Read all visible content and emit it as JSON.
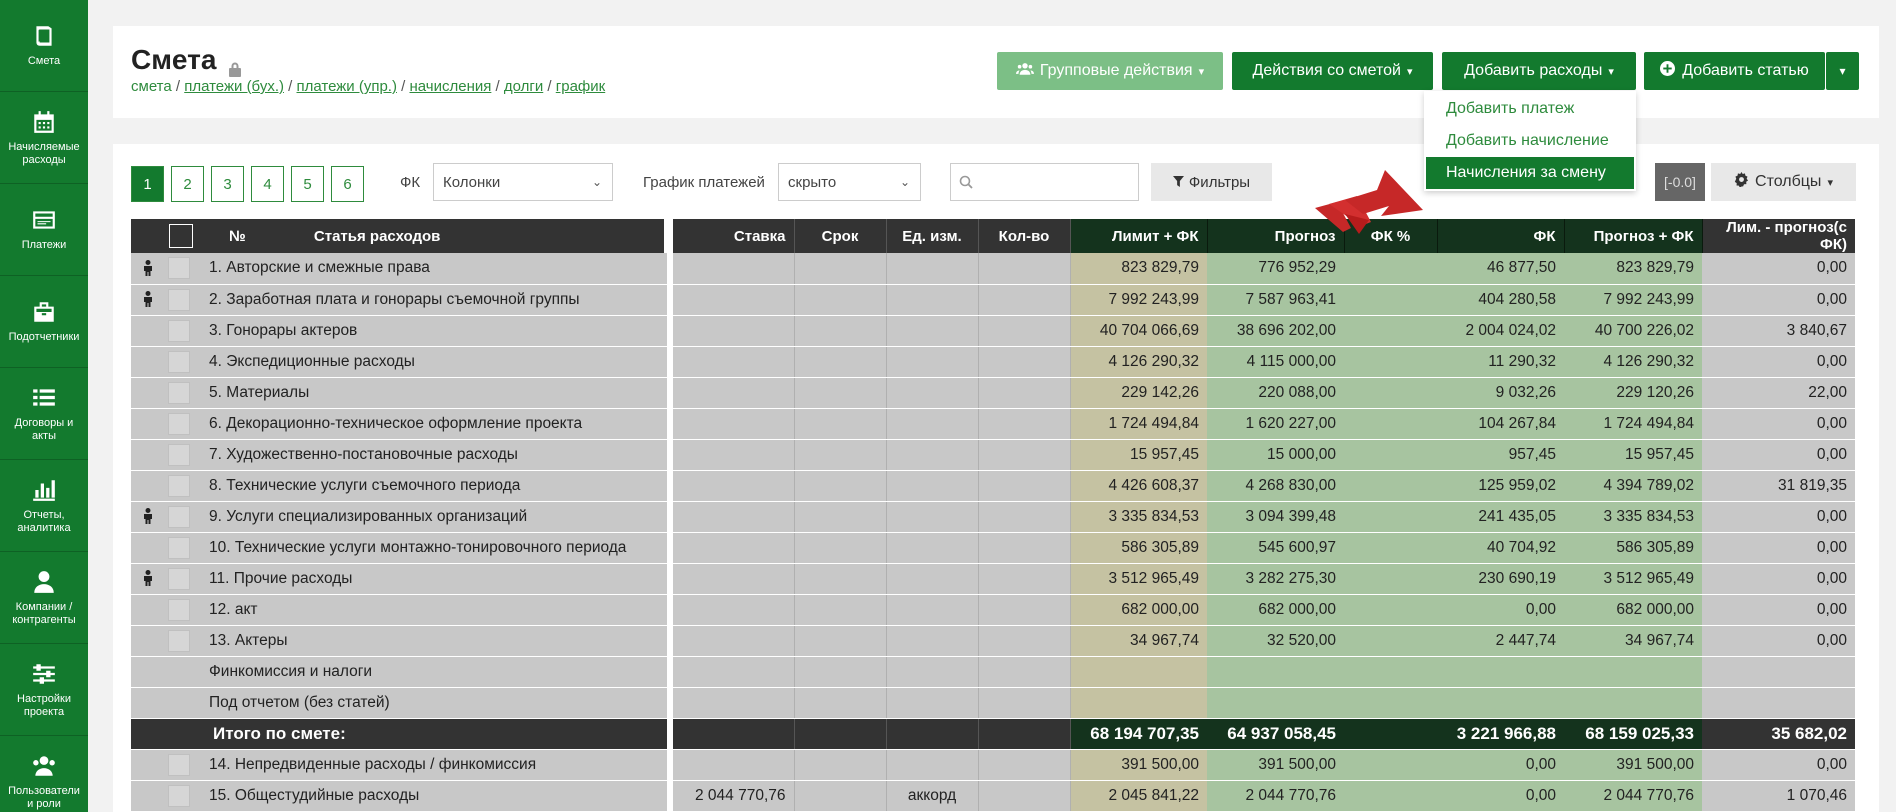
{
  "sidebar": {
    "items": [
      {
        "label": "Смета",
        "icon": "book-icon"
      },
      {
        "label": "Начисляемые расходы",
        "icon": "calendar-icon"
      },
      {
        "label": "Платежи",
        "icon": "payments-icon"
      },
      {
        "label": "Подотчетники",
        "icon": "briefcase-icon"
      },
      {
        "label": "Договоры и акты",
        "icon": "list-icon"
      },
      {
        "label": "Отчеты, аналитика",
        "icon": "chart-icon"
      },
      {
        "label": "Компании / контрагенты",
        "icon": "user-icon"
      },
      {
        "label": "Настройки проекта",
        "icon": "sliders-icon"
      },
      {
        "label": "Пользователи и роли",
        "icon": "users-icon"
      }
    ]
  },
  "header": {
    "title": "Смета",
    "breadcrumb": {
      "home": "смета",
      "links": [
        "платежи (бух.)",
        "платежи (упр.)",
        "начисления",
        "долги",
        "график"
      ]
    },
    "buttons": {
      "group_actions": "Групповые действия",
      "estimate_actions": "Действия со сметой",
      "add_expenses": "Добавить расходы",
      "add_item": "Добавить статью"
    },
    "dropdown": {
      "items": [
        "Добавить платеж",
        "Добавить начисление",
        "Начисления за смену"
      ],
      "active_index": 2
    }
  },
  "toolbar": {
    "pages": [
      "1",
      "2",
      "3",
      "4",
      "5",
      "6"
    ],
    "active_page": "1",
    "fk_label": "ФК",
    "fk_value": "Колонки",
    "schedule_label": "График платежей",
    "schedule_value": "скрыто",
    "search_placeholder": "",
    "filters_label": "Фильтры",
    "zoom": "[-0.0]",
    "columns_label": "Столбцы"
  },
  "table": {
    "headers": {
      "num": "№",
      "name": "Статья расходов",
      "rate": "Ставка",
      "term": "Срок",
      "unit": "Ед. изм.",
      "qty": "Кол-во",
      "limit_fc": "Лимит + ФК",
      "forecast": "Прогноз",
      "fc_pct": "ФК %",
      "fc": "ФК",
      "forecast_fc": "Прогноз + ФК",
      "limit_minus_forecast": "Лим. - прогноз(с ФК)"
    },
    "rows": [
      {
        "person": true,
        "checkbox": true,
        "name": "1. Авторские и смежные права",
        "rate": "",
        "unit": "",
        "limit_fc": "823 829,79",
        "forecast": "776 952,29",
        "fc": "46 877,50",
        "forecast_fc": "823 829,79",
        "diff": "0,00"
      },
      {
        "person": true,
        "checkbox": true,
        "name": "2. Заработная плата и гонорары съемочной группы",
        "rate": "",
        "unit": "",
        "limit_fc": "7 992 243,99",
        "forecast": "7 587 963,41",
        "fc": "404 280,58",
        "forecast_fc": "7 992 243,99",
        "diff": "0,00"
      },
      {
        "person": false,
        "checkbox": true,
        "name": "3. Гонорары актеров",
        "rate": "",
        "unit": "",
        "limit_fc": "40 704 066,69",
        "forecast": "38 696 202,00",
        "fc": "2 004 024,02",
        "forecast_fc": "40 700 226,02",
        "diff": "3 840,67"
      },
      {
        "person": false,
        "checkbox": true,
        "name": "4. Экспедиционные расходы",
        "rate": "",
        "unit": "",
        "limit_fc": "4 126 290,32",
        "forecast": "4 115 000,00",
        "fc": "11 290,32",
        "forecast_fc": "4 126 290,32",
        "diff": "0,00"
      },
      {
        "person": false,
        "checkbox": true,
        "name": "5. Материалы",
        "rate": "",
        "unit": "",
        "limit_fc": "229 142,26",
        "forecast": "220 088,00",
        "fc": "9 032,26",
        "forecast_fc": "229 120,26",
        "diff": "22,00"
      },
      {
        "person": false,
        "checkbox": true,
        "name": "6. Декорационно-техническое оформление проекта",
        "rate": "",
        "unit": "",
        "limit_fc": "1 724 494,84",
        "forecast": "1 620 227,00",
        "fc": "104 267,84",
        "forecast_fc": "1 724 494,84",
        "diff": "0,00"
      },
      {
        "person": false,
        "checkbox": true,
        "name": "7. Художественно-постановочные расходы",
        "rate": "",
        "unit": "",
        "limit_fc": "15 957,45",
        "forecast": "15 000,00",
        "fc": "957,45",
        "forecast_fc": "15 957,45",
        "diff": "0,00"
      },
      {
        "person": false,
        "checkbox": true,
        "name": "8. Технические услуги съемочного периода",
        "rate": "",
        "unit": "",
        "limit_fc": "4 426 608,37",
        "forecast": "4 268 830,00",
        "fc": "125 959,02",
        "forecast_fc": "4 394 789,02",
        "diff": "31 819,35"
      },
      {
        "person": true,
        "checkbox": true,
        "name": "9. Услуги специализированных организаций",
        "rate": "",
        "unit": "",
        "limit_fc": "3 335 834,53",
        "forecast": "3 094 399,48",
        "fc": "241 435,05",
        "forecast_fc": "3 335 834,53",
        "diff": "0,00"
      },
      {
        "person": false,
        "checkbox": true,
        "name": "10. Технические услуги монтажно-тонировочного периода",
        "rate": "",
        "unit": "",
        "limit_fc": "586 305,89",
        "forecast": "545 600,97",
        "fc": "40 704,92",
        "forecast_fc": "586 305,89",
        "diff": "0,00"
      },
      {
        "person": true,
        "checkbox": true,
        "name": "11. Прочие расходы",
        "rate": "",
        "unit": "",
        "limit_fc": "3 512 965,49",
        "forecast": "3 282 275,30",
        "fc": "230 690,19",
        "forecast_fc": "3 512 965,49",
        "diff": "0,00"
      },
      {
        "person": false,
        "checkbox": true,
        "name": "12. акт",
        "rate": "",
        "unit": "",
        "limit_fc": "682 000,00",
        "forecast": "682 000,00",
        "fc": "0,00",
        "forecast_fc": "682 000,00",
        "diff": "0,00"
      },
      {
        "person": false,
        "checkbox": true,
        "name": "13. Актеры",
        "rate": "",
        "unit": "",
        "limit_fc": "34 967,74",
        "forecast": "32 520,00",
        "fc": "2 447,74",
        "forecast_fc": "34 967,74",
        "diff": "0,00"
      },
      {
        "person": false,
        "checkbox": false,
        "name": "Финкомиссия и налоги",
        "rate": "",
        "unit": "",
        "limit_fc": "",
        "forecast": "",
        "fc": "",
        "forecast_fc": "",
        "diff": ""
      },
      {
        "person": false,
        "checkbox": false,
        "name": "Под отчетом (без статей)",
        "rate": "",
        "unit": "",
        "limit_fc": "",
        "forecast": "",
        "fc": "",
        "forecast_fc": "",
        "diff": ""
      }
    ],
    "total": {
      "label": "Итого по смете:",
      "limit_fc": "68 194 707,35",
      "forecast": "64 937 058,45",
      "fc": "3 221 966,88",
      "forecast_fc": "68 159 025,33",
      "diff": "35 682,02"
    },
    "after_rows": [
      {
        "person": false,
        "checkbox": true,
        "name": "14. Непредвиденные расходы / финкомиссия",
        "rate": "",
        "unit": "",
        "limit_fc": "391 500,00",
        "forecast": "391 500,00",
        "fc": "0,00",
        "forecast_fc": "391 500,00",
        "diff": "0,00"
      },
      {
        "person": false,
        "checkbox": true,
        "name": "15. Общестудийные расходы",
        "rate": "2 044 770,76",
        "unit": "аккорд",
        "limit_fc": "2 045 841,22",
        "forecast": "2 044 770,76",
        "fc": "0,00",
        "forecast_fc": "2 044 770,76",
        "diff": "1 070,46"
      }
    ]
  },
  "colors": {
    "brand_green": "#137a2e",
    "light_green": "#7cbf86",
    "link_green": "#2e8b3d",
    "arrow_red": "#c62828"
  }
}
